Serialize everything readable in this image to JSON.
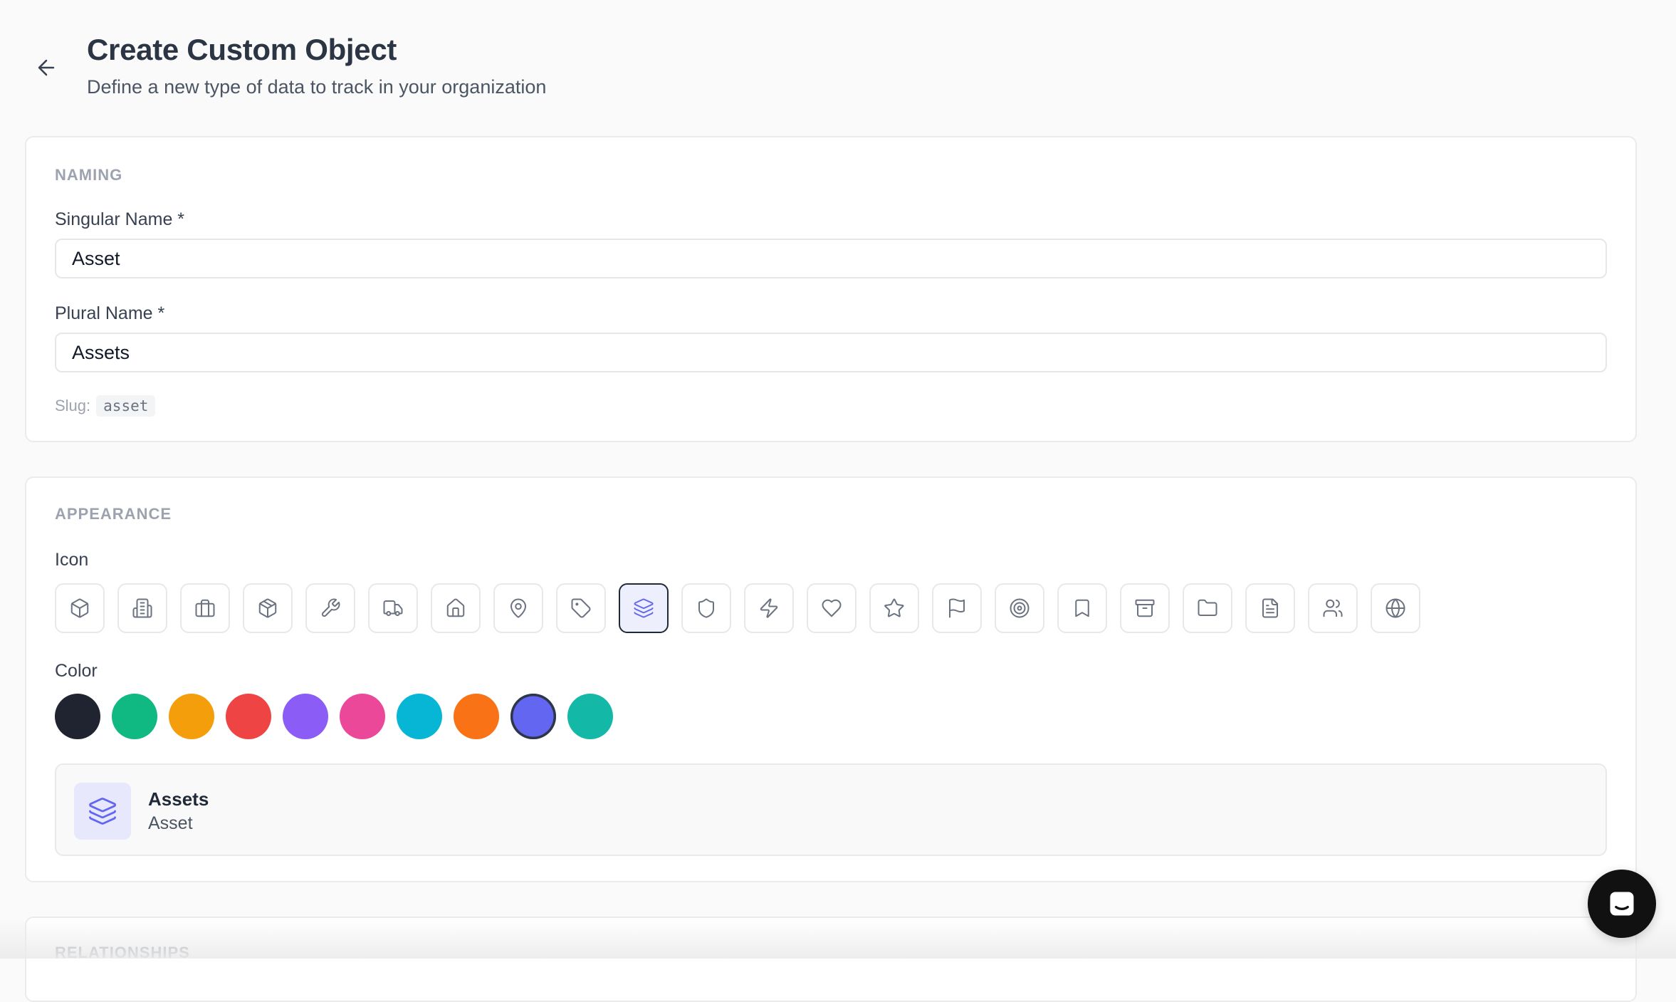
{
  "header": {
    "title": "Create Custom Object",
    "subtitle": "Define a new type of data to track in your organization",
    "back_icon": "arrow-left-icon"
  },
  "naming": {
    "section_label": "NAMING",
    "singular_label": "Singular Name *",
    "singular_value": "Asset",
    "plural_label": "Plural Name *",
    "plural_value": "Assets",
    "slug_label": "Slug:",
    "slug_value": "asset"
  },
  "appearance": {
    "section_label": "APPEARANCE",
    "icon_label": "Icon",
    "icons": [
      "cube-icon",
      "building-icon",
      "briefcase-icon",
      "package-icon",
      "wrench-icon",
      "truck-icon",
      "home-icon",
      "map-pin-icon",
      "tag-icon",
      "layers-icon",
      "shield-icon",
      "zap-icon",
      "heart-icon",
      "star-icon",
      "flag-icon",
      "target-icon",
      "bookmark-icon",
      "archive-icon",
      "folder-icon",
      "file-text-icon",
      "users-icon",
      "globe-icon"
    ],
    "selected_icon": "layers-icon",
    "color_label": "Color",
    "colors": [
      "#1f2430",
      "#10b981",
      "#f59e0b",
      "#ef4444",
      "#8b5cf6",
      "#ec4899",
      "#06b6d4",
      "#f97316",
      "#6366f1",
      "#14b8a6"
    ],
    "selected_color": "#6366f1",
    "preview": {
      "plural": "Assets",
      "singular": "Asset",
      "icon": "layers-icon"
    }
  },
  "relationships": {
    "section_label": "RELATIONSHIPS"
  },
  "chat_widget": {
    "icon": "chat-icon"
  }
}
